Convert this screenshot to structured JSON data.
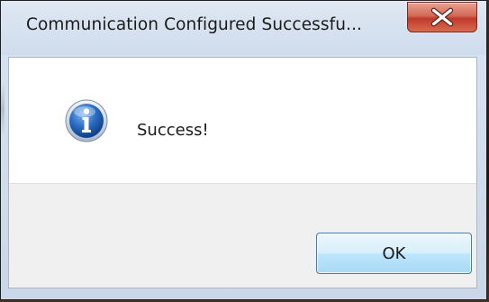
{
  "window": {
    "title": "Communication Configured Successfu...",
    "close_icon": "close-icon"
  },
  "dialog": {
    "icon": "info-icon",
    "message": "Success!",
    "ok_label": "OK"
  },
  "colors": {
    "close_button": "#c0392b",
    "info_blue": "#1f5fb0",
    "ok_button_border": "#3c7fb1",
    "footer_bg": "#f0f0f0"
  }
}
